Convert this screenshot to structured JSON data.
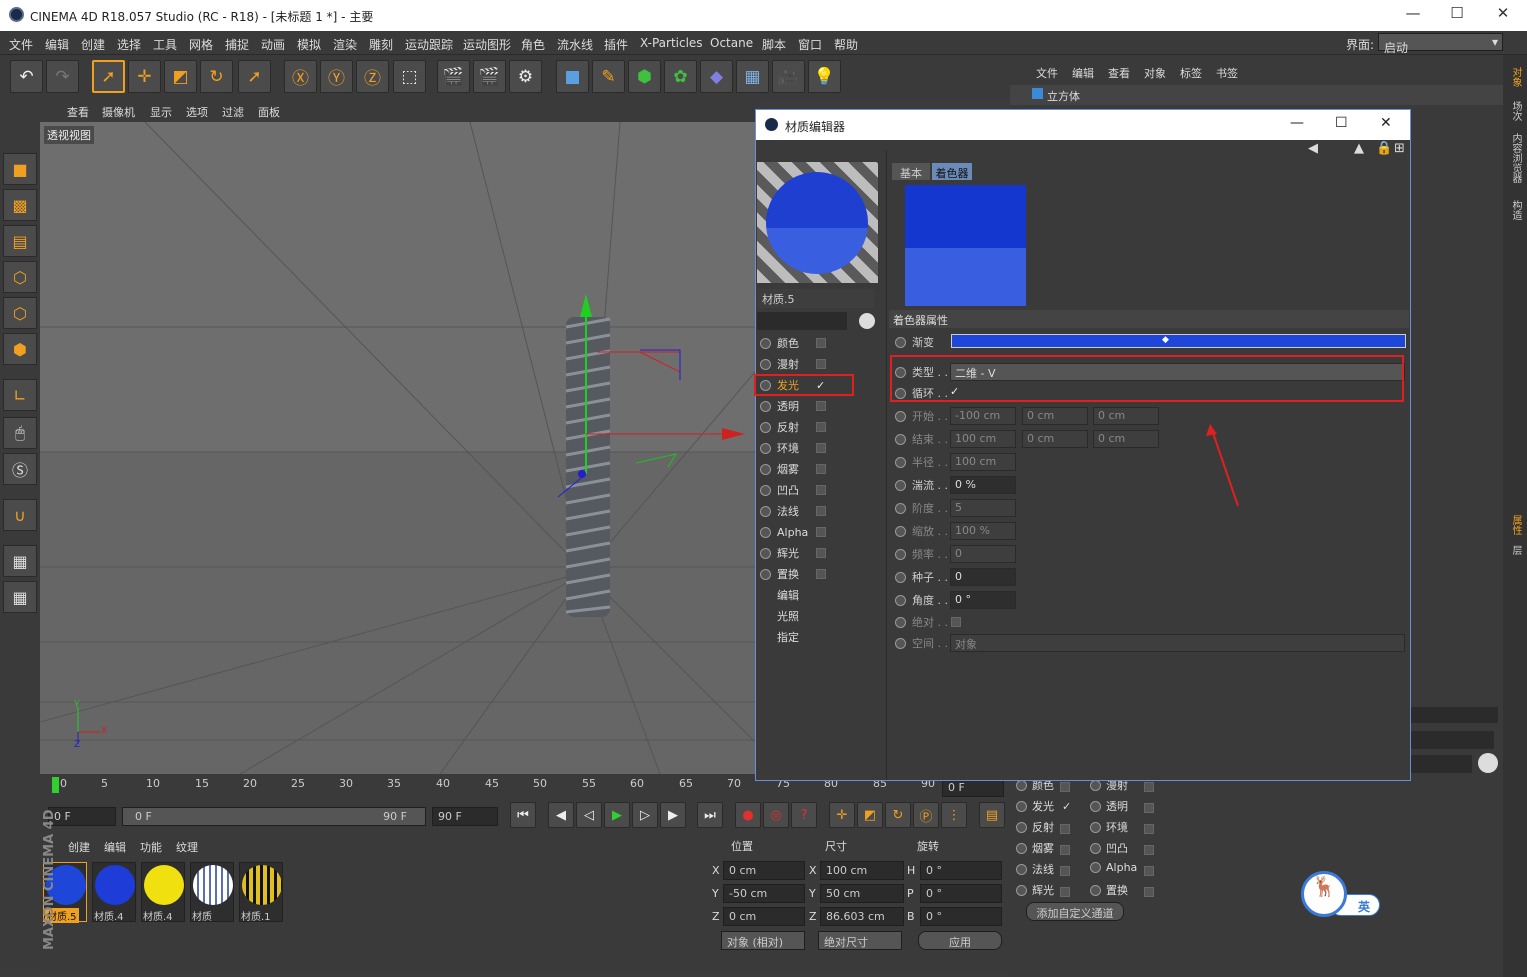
{
  "window": {
    "title": "CINEMA 4D R18.057 Studio (RC - R18) - [未标题 1 *] - 主要",
    "minimize": "—",
    "maximize": "☐",
    "close": "✕"
  },
  "menu": [
    "文件",
    "编辑",
    "创建",
    "选择",
    "工具",
    "网格",
    "捕捉",
    "动画",
    "模拟",
    "渲染",
    "雕刻",
    "运动跟踪",
    "运动图形",
    "角色",
    "流水线",
    "插件",
    "X-Particles",
    "Octane",
    "脚本",
    "窗口",
    "帮助"
  ],
  "layout": {
    "label": "界面:",
    "value": "启动"
  },
  "viewport": {
    "menu": [
      "查看",
      "摄像机",
      "显示",
      "选项",
      "过滤",
      "面板"
    ],
    "name": "透视视图",
    "axis_x": "X",
    "axis_y": "Y",
    "axis_z": "Z"
  },
  "timeline": {
    "ticks": [
      "0",
      "5",
      "10",
      "15",
      "20",
      "25",
      "30",
      "35",
      "40",
      "45",
      "50",
      "55",
      "60",
      "65",
      "70",
      "75",
      "80",
      "85",
      "90"
    ],
    "current": "0 F"
  },
  "transport": {
    "start": "0 F",
    "range_start": "0 F",
    "range_end": "90 F",
    "end": "90 F"
  },
  "material_manager": {
    "menu": [
      "创建",
      "编辑",
      "功能",
      "纹理"
    ],
    "materials": [
      {
        "name": "材质.5",
        "color": "#1e46d8",
        "selected": true
      },
      {
        "name": "材质.4",
        "color": "#1e3cd8"
      },
      {
        "name": "材质.4",
        "color": "#f0e010"
      },
      {
        "name": "材质",
        "color": "#ffffff"
      },
      {
        "name": "材质.1",
        "color": "#e0c020"
      }
    ]
  },
  "coordinates": {
    "headers": [
      "位置",
      "尺寸",
      "旋转"
    ],
    "rows": [
      {
        "axis": "X",
        "pos": "0 cm",
        "size_axis": "X",
        "size": "100 cm",
        "rot_axis": "H",
        "rot": "0 °"
      },
      {
        "axis": "Y",
        "pos": "-50 cm",
        "size_axis": "Y",
        "size": "50 cm",
        "rot_axis": "P",
        "rot": "0 °"
      },
      {
        "axis": "Z",
        "pos": "0 cm",
        "size_axis": "Z",
        "size": "86.603 cm",
        "rot_axis": "B",
        "rot": "0 °"
      }
    ],
    "mode": "对象 (相对)",
    "size_mode": "绝对尺寸",
    "apply": "应用"
  },
  "object_manager": {
    "menu": [
      "文件",
      "编辑",
      "查看",
      "对象",
      "标签",
      "书签"
    ],
    "object": "立方体"
  },
  "right_tabs": [
    "对象",
    "场次",
    "内容浏览器",
    "构造"
  ],
  "right_tabs2": [
    "属性",
    "层"
  ],
  "attr_channels": {
    "left": [
      "颜色",
      "发光",
      "反射",
      "烟雾",
      "法线",
      "辉光"
    ],
    "right": [
      "漫射",
      "透明",
      "环境",
      "凹凸",
      "Alpha",
      "置换"
    ],
    "add_button": "添加自定义通道",
    "emission_checked": "✓"
  },
  "material_editor": {
    "title": "材质编辑器",
    "name": "材质.5",
    "channels": [
      {
        "label": "颜色"
      },
      {
        "label": "漫射"
      },
      {
        "label": "发光",
        "checked": "✓"
      },
      {
        "label": "透明"
      },
      {
        "label": "反射"
      },
      {
        "label": "环境"
      },
      {
        "label": "烟雾"
      },
      {
        "label": "凹凸"
      },
      {
        "label": "法线"
      },
      {
        "label": "Alpha"
      },
      {
        "label": "辉光"
      },
      {
        "label": "置换"
      }
    ],
    "extra": [
      "编辑",
      "光照",
      "指定"
    ],
    "tabs": [
      "基本",
      "着色器"
    ],
    "section": "着色器属性",
    "props": {
      "gradient": "渐变",
      "type_label": "类型 . .",
      "type_value": "二维 - V",
      "cycle_label": "循环 . .",
      "cycle_check": "✓",
      "start_label": "开始 . .",
      "start": [
        "-100 cm",
        "0 cm",
        "0 cm"
      ],
      "end_label": "结束 . .",
      "end": [
        "100 cm",
        "0 cm",
        "0 cm"
      ],
      "radius_label": "半径 . .",
      "radius": "100 cm",
      "turb_label": "湍流 . .",
      "turb": "0 %",
      "octave_label": "阶度 . .",
      "octave": "5",
      "scale_label": "缩放 . .",
      "scale": "100 %",
      "freq_label": "频率 . .",
      "freq": "0",
      "seed_label": "种子 . .",
      "seed": "0",
      "angle_label": "角度 . .",
      "angle": "0 °",
      "abs_label": "绝对 . .",
      "space_label": "空间 . .",
      "space": "对象"
    }
  },
  "ime": {
    "label": "英"
  },
  "colors": {
    "accent": "#f0a020",
    "blue": "#1e46d8",
    "highlight": "#e02020"
  }
}
